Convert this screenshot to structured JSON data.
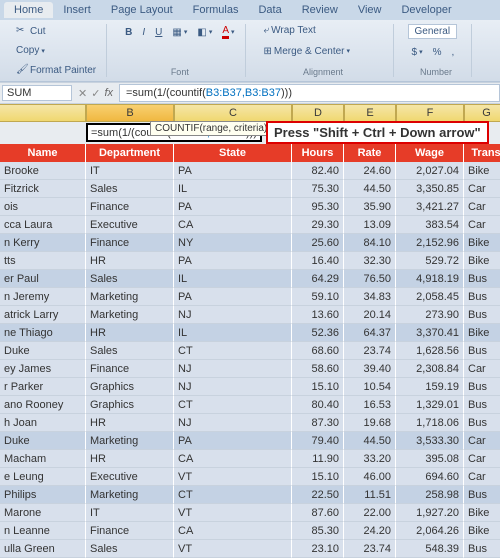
{
  "ribbon": {
    "tabs": [
      "Home",
      "Insert",
      "Page Layout",
      "Formulas",
      "Data",
      "Review",
      "View",
      "Developer"
    ],
    "active_tab": 0,
    "clipboard": {
      "cut": "Cut",
      "copy": "Copy",
      "format_painter": "Format Painter"
    },
    "alignment": {
      "wrap": "Wrap Text",
      "merge": "Merge & Center"
    },
    "number_format": "General",
    "group_labels": {
      "font": "Font",
      "alignment": "Alignment",
      "number": "Number"
    }
  },
  "formula_bar": {
    "namebox": "SUM",
    "fx": "fx",
    "prefix": "=sum(1/(countif(",
    "ref": "B3:B37,B3:B37",
    "suffix": ")))"
  },
  "col_headers": [
    "B",
    "C",
    "D",
    "E",
    "F",
    "G"
  ],
  "cell_edit": {
    "prefix": "=sum(1/(countif(",
    "ref": "B3:B37,B3:B37",
    "suffix": ")))"
  },
  "tooltip": "COUNTIF(range, criteria)",
  "instruction": "Press \"Shift + Ctrl + Down arrow\"",
  "table": {
    "headers": [
      "Name",
      "Department",
      "State",
      "Hours",
      "Rate",
      "Wage",
      "Trans"
    ],
    "rows": [
      {
        "name": "Brooke",
        "dept": "IT",
        "state": "PA",
        "hours": "82.40",
        "rate": "24.60",
        "wage": "2,027.04",
        "trans": "Bike"
      },
      {
        "name": "Fitzrick",
        "dept": "Sales",
        "state": "IL",
        "hours": "75.30",
        "rate": "44.50",
        "wage": "3,350.85",
        "trans": "Car"
      },
      {
        "name": "ois",
        "dept": "Finance",
        "state": "PA",
        "hours": "95.30",
        "rate": "35.90",
        "wage": "3,421.27",
        "trans": "Car"
      },
      {
        "name": "cca Laura",
        "dept": "Executive",
        "state": "CA",
        "hours": "29.30",
        "rate": "13.09",
        "wage": "383.54",
        "trans": "Car"
      },
      {
        "name": "n Kerry",
        "dept": "Finance",
        "state": "NY",
        "hours": "25.60",
        "rate": "84.10",
        "wage": "2,152.96",
        "trans": "Bike"
      },
      {
        "name": "tts",
        "dept": "HR",
        "state": "PA",
        "hours": "16.40",
        "rate": "32.30",
        "wage": "529.72",
        "trans": "Bike"
      },
      {
        "name": "er Paul",
        "dept": "Sales",
        "state": "IL",
        "hours": "64.29",
        "rate": "76.50",
        "wage": "4,918.19",
        "trans": "Bus"
      },
      {
        "name": "n Jeremy",
        "dept": "Marketing",
        "state": "PA",
        "hours": "59.10",
        "rate": "34.83",
        "wage": "2,058.45",
        "trans": "Bus"
      },
      {
        "name": "atrick Larry",
        "dept": "Marketing",
        "state": "NJ",
        "hours": "13.60",
        "rate": "20.14",
        "wage": "273.90",
        "trans": "Bus"
      },
      {
        "name": "ne Thiago",
        "dept": "HR",
        "state": "IL",
        "hours": "52.36",
        "rate": "64.37",
        "wage": "3,370.41",
        "trans": "Bike"
      },
      {
        "name": "Duke",
        "dept": "Sales",
        "state": "CT",
        "hours": "68.60",
        "rate": "23.74",
        "wage": "1,628.56",
        "trans": "Bus"
      },
      {
        "name": "ey James",
        "dept": "Finance",
        "state": "NJ",
        "hours": "58.60",
        "rate": "39.40",
        "wage": "2,308.84",
        "trans": "Car"
      },
      {
        "name": "r Parker",
        "dept": "Graphics",
        "state": "NJ",
        "hours": "15.10",
        "rate": "10.54",
        "wage": "159.19",
        "trans": "Bus"
      },
      {
        "name": "ano Rooney",
        "dept": "Graphics",
        "state": "CT",
        "hours": "80.40",
        "rate": "16.53",
        "wage": "1,329.01",
        "trans": "Bus"
      },
      {
        "name": "h Joan",
        "dept": "HR",
        "state": "NJ",
        "hours": "87.30",
        "rate": "19.68",
        "wage": "1,718.06",
        "trans": "Bus"
      },
      {
        "name": "Duke",
        "dept": "Marketing",
        "state": "PA",
        "hours": "79.40",
        "rate": "44.50",
        "wage": "3,533.30",
        "trans": "Car"
      },
      {
        "name": "Macham",
        "dept": "HR",
        "state": "CA",
        "hours": "11.90",
        "rate": "33.20",
        "wage": "395.08",
        "trans": "Car"
      },
      {
        "name": "e Leung",
        "dept": "Executive",
        "state": "VT",
        "hours": "15.10",
        "rate": "46.00",
        "wage": "694.60",
        "trans": "Car"
      },
      {
        "name": "Philips",
        "dept": "Marketing",
        "state": "CT",
        "hours": "22.50",
        "rate": "11.51",
        "wage": "258.98",
        "trans": "Bus"
      },
      {
        "name": "Marone",
        "dept": "IT",
        "state": "VT",
        "hours": "87.60",
        "rate": "22.00",
        "wage": "1,927.20",
        "trans": "Bike"
      },
      {
        "name": "n Leanne",
        "dept": "Finance",
        "state": "CA",
        "hours": "85.30",
        "rate": "24.20",
        "wage": "2,064.26",
        "trans": "Bike"
      },
      {
        "name": "ulla Green",
        "dept": "Sales",
        "state": "VT",
        "hours": "23.10",
        "rate": "23.74",
        "wage": "548.39",
        "trans": "Bus"
      }
    ]
  },
  "chart_data": {
    "type": "table",
    "columns": [
      "Name",
      "Department",
      "State",
      "Hours",
      "Rate",
      "Wage",
      "Trans"
    ],
    "rows": [
      [
        "Brooke",
        "IT",
        "PA",
        82.4,
        24.6,
        2027.04,
        "Bike"
      ],
      [
        "Fitzrick",
        "Sales",
        "IL",
        75.3,
        44.5,
        3350.85,
        "Car"
      ],
      [
        "ois",
        "Finance",
        "PA",
        95.3,
        35.9,
        3421.27,
        "Car"
      ],
      [
        "cca Laura",
        "Executive",
        "CA",
        29.3,
        13.09,
        383.54,
        "Car"
      ],
      [
        "n Kerry",
        "Finance",
        "NY",
        25.6,
        84.1,
        2152.96,
        "Bike"
      ],
      [
        "tts",
        "HR",
        "PA",
        16.4,
        32.3,
        529.72,
        "Bike"
      ],
      [
        "er Paul",
        "Sales",
        "IL",
        64.29,
        76.5,
        4918.19,
        "Bus"
      ],
      [
        "n Jeremy",
        "Marketing",
        "PA",
        59.1,
        34.83,
        2058.45,
        "Bus"
      ],
      [
        "atrick Larry",
        "Marketing",
        "NJ",
        13.6,
        20.14,
        273.9,
        "Bus"
      ],
      [
        "ne Thiago",
        "HR",
        "IL",
        52.36,
        64.37,
        3370.41,
        "Bike"
      ],
      [
        "Duke",
        "Sales",
        "CT",
        68.6,
        23.74,
        1628.56,
        "Bus"
      ],
      [
        "ey James",
        "Finance",
        "NJ",
        58.6,
        39.4,
        2308.84,
        "Car"
      ],
      [
        "r Parker",
        "Graphics",
        "NJ",
        15.1,
        10.54,
        159.19,
        "Bus"
      ],
      [
        "ano Rooney",
        "Graphics",
        "CT",
        80.4,
        16.53,
        1329.01,
        "Bus"
      ],
      [
        "h Joan",
        "HR",
        "NJ",
        87.3,
        19.68,
        1718.06,
        "Bus"
      ],
      [
        "Duke",
        "Marketing",
        "PA",
        79.4,
        44.5,
        3533.3,
        "Car"
      ],
      [
        "Macham",
        "HR",
        "CA",
        11.9,
        33.2,
        395.08,
        "Car"
      ],
      [
        "e Leung",
        "Executive",
        "VT",
        15.1,
        46.0,
        694.6,
        "Car"
      ],
      [
        "Philips",
        "Marketing",
        "CT",
        22.5,
        11.51,
        258.98,
        "Bus"
      ],
      [
        "Marone",
        "IT",
        "VT",
        87.6,
        22.0,
        1927.2,
        "Bike"
      ],
      [
        "n Leanne",
        "Finance",
        "CA",
        85.3,
        24.2,
        2064.26,
        "Bike"
      ],
      [
        "ulla Green",
        "Sales",
        "VT",
        23.1,
        23.74,
        548.39,
        "Bus"
      ]
    ]
  }
}
